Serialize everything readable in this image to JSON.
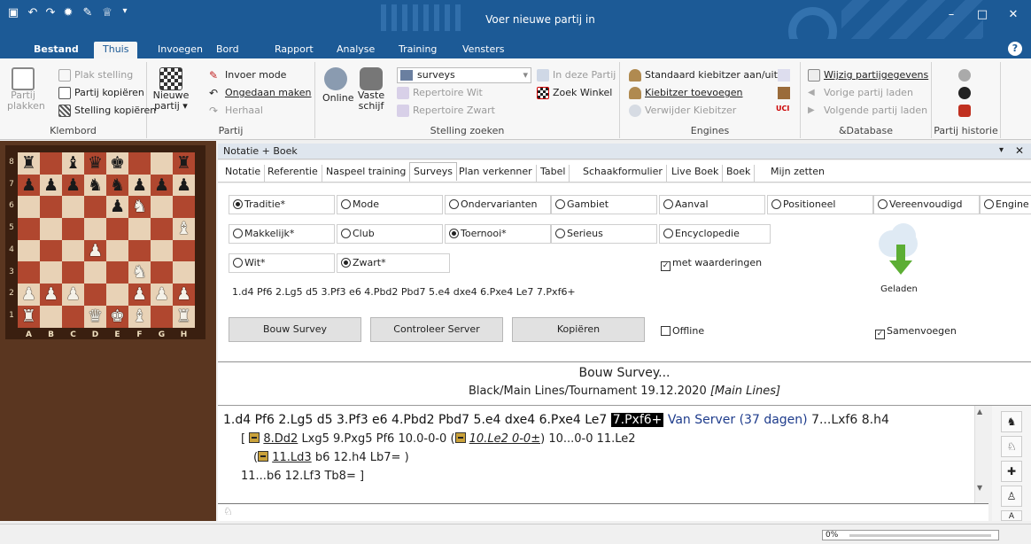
{
  "window": {
    "title": "Voer nieuwe partij in"
  },
  "ribbon_tabs": [
    "Bestand",
    "Thuis",
    "Invoegen",
    "Bord",
    "Rapport",
    "Analyse",
    "Training",
    "Vensters"
  ],
  "ribbon": {
    "klembord": {
      "label": "Klembord",
      "paste_line1": "Partij",
      "paste_line2": "plakken",
      "plak_stelling": "Plak stelling",
      "partij_kopieren": "Partij kopiëren",
      "stelling_kopieren": "Stelling kopiëren"
    },
    "partij": {
      "label": "Partij",
      "nieuwe1": "Nieuwe",
      "nieuwe2": "partij ▾",
      "invoer_mode": "Invoer mode",
      "ongedaan": "Ongedaan maken",
      "herhaal": "Herhaal"
    },
    "stelling_zoeken": {
      "label": "Stelling zoeken",
      "online": "Online",
      "vaste1": "Vaste",
      "vaste2": "schijf",
      "combo_value": "surveys",
      "in_deze_partij": "In deze Partij",
      "zoek_winkel": "Zoek Winkel",
      "rep_wit": "Repertoire Wit",
      "rep_zwart": "Repertoire Zwart"
    },
    "engines": {
      "label": "Engines",
      "std": "Standaard kiebitzer aan/uit",
      "add": "Kiebitzer toevoegen",
      "remove": "Verwijder Kiebitzer"
    },
    "database": {
      "label": "&Database",
      "wijzig": "Wijzig partijgegevens",
      "vorige": "Vorige partij laden",
      "volgende": "Volgende partij laden"
    },
    "historie": {
      "label": "Partij historie"
    }
  },
  "board": {
    "ranks": [
      "8",
      "7",
      "6",
      "5",
      "4",
      "3",
      "2",
      "1"
    ],
    "files": [
      "A",
      "B",
      "C",
      "D",
      "E",
      "F",
      "G",
      "H"
    ],
    "rows": [
      [
        "bR",
        "",
        "bB",
        "bQ",
        "bK",
        "",
        "",
        "bR"
      ],
      [
        "bP",
        "bP",
        "bP",
        "bN",
        "bN",
        "bP",
        "bP",
        "bP"
      ],
      [
        "",
        "",
        "",
        "",
        "bP",
        "wN",
        "",
        ""
      ],
      [
        "",
        "",
        "",
        "",
        "",
        "",
        "",
        "wB"
      ],
      [
        "",
        "",
        "",
        "wP",
        "",
        "",
        "",
        ""
      ],
      [
        "",
        "",
        "",
        "",
        "",
        "wN",
        "",
        ""
      ],
      [
        "wP",
        "wP",
        "wP",
        "",
        "",
        "wP",
        "wP",
        "wP"
      ],
      [
        "wR",
        "",
        "",
        "wQ",
        "wK",
        "wB",
        "",
        "wR"
      ]
    ]
  },
  "pane": {
    "title": "Notatie + Boek"
  },
  "subtabs": [
    "Notatie",
    "Referentie",
    "Naspeel training",
    "Surveys",
    "Plan verkenner",
    "Tabel",
    "Schaakformulier",
    "Live Boek",
    "Boek",
    "Mijn zetten"
  ],
  "surveys": {
    "row1": [
      "Traditie*",
      "Mode",
      "Ondervarianten",
      "Gambiet",
      "Aanval",
      "Positioneel",
      "Vereenvoudigd",
      "Engine"
    ],
    "row2": [
      "Makkelijk*",
      "Club",
      "Toernooi*",
      "Serieus",
      "Encyclopedie"
    ],
    "row3": [
      "Wit*",
      "Zwart*"
    ],
    "met_waarderingen": "met waarderingen",
    "moves": "1.d4 Pf6 2.Lg5 d5 3.Pf3 e6 4.Pbd2 Pbd7 5.e4 dxe4 6.Pxe4 Le7 7.Pxf6+",
    "geladen": "Geladen",
    "buttons": [
      "Bouw Survey",
      "Controleer Server",
      "Kopiëren"
    ],
    "offline": "Offline",
    "samenvoegen": "Samenvoegen"
  },
  "status": {
    "title": "Bouw Survey...",
    "subtitle": "Black/Main Lines/Tournament 19.12.2020",
    "subtitle_it": "[Main Lines]"
  },
  "notation": {
    "main1": "1.d4 Pf6 2.Lg5 d5 3.Pf3 e6 4.Pbd2 Pbd7 5.e4 dxe4 6.Pxe4 Le7",
    "current": "7.Pxf6+",
    "server": "Van Server (37 dagen)",
    "main2": "7...Lxf6 8.h4",
    "v1a": "[",
    "v1b": "8.Dd2",
    "v1c": "Lxg5 9.Pxg5 Pf6 10.0-0-0 (",
    "v1d": "10.Le2 0-0±",
    "v1e": ") 10...0-0 11.Le2",
    "v2a": "(",
    "v2b": "11.Ld3",
    "v2c": "b6 12.h4 Lb7= )",
    "v3": "11...b6 12.Lf3 Tb8= ]"
  },
  "statusbar": {
    "progress": "0%"
  }
}
